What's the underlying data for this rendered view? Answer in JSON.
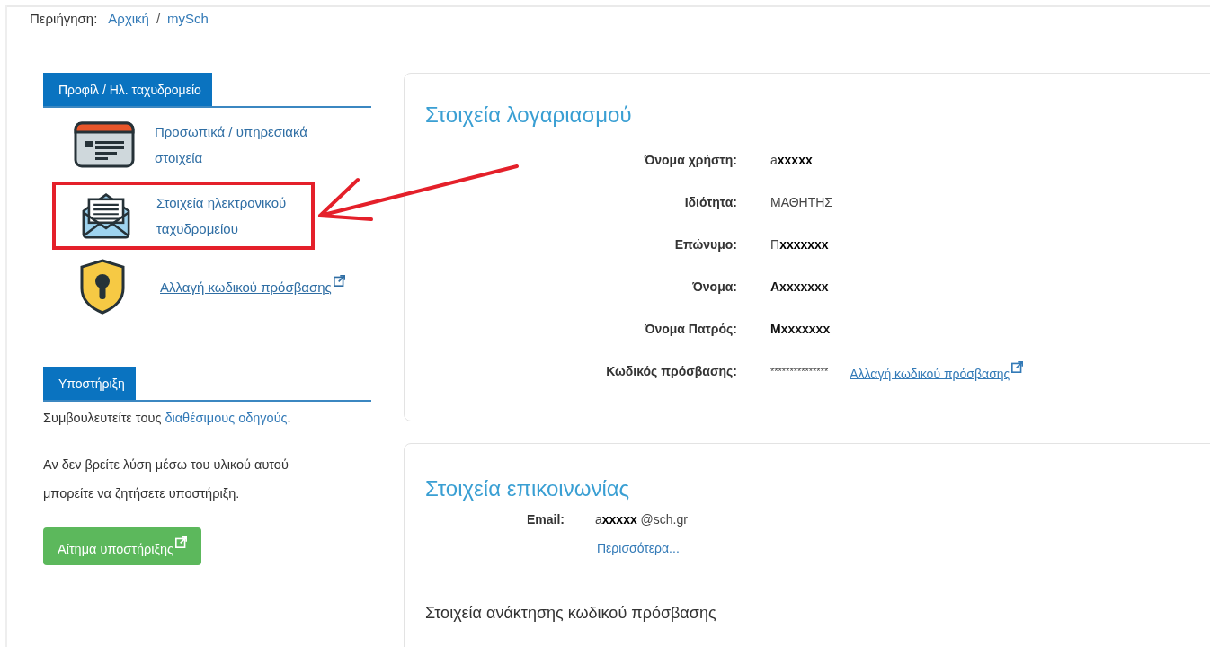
{
  "breadcrumb": {
    "label": "Περιήγηση:",
    "separator": "/",
    "items": [
      {
        "text": "Αρχική"
      },
      {
        "text": "mySch"
      }
    ]
  },
  "profile": {
    "header": "Προφίλ / Ηλ. ταχυδρομείο",
    "items": [
      {
        "kind": "card",
        "text": "Προσωπικά / υπηρεσιακά στοιχεία",
        "external": false,
        "annotated": false
      },
      {
        "kind": "mail",
        "text": "Στοιχεία ηλεκτρονικού ταχυδρομείου",
        "external": false,
        "annotated": true
      },
      {
        "kind": "shield",
        "text": "Αλλαγή κωδικού πρόσβασης",
        "external": true,
        "annotated": false
      }
    ]
  },
  "support": {
    "header": "Υποστήριξη",
    "note": {
      "before": "Συμβουλευτείτε τους ",
      "link": "διαθέσιμους οδηγούς",
      "after": "."
    },
    "paragraph": "Αν δεν βρείτε λύση μέσω του υλικού αυτού μπορείτε να ζητήσετε υποστήριξη.",
    "button": "Αίτημα υποστήριξης"
  },
  "account": {
    "title": "Στοιχεία λογαριασμού",
    "rows": [
      {
        "kind": "text",
        "label": "Όνομα χρήστη:",
        "value": "a**xxxxx**",
        "bold": false
      },
      {
        "kind": "text",
        "label": "Ιδιότητα:",
        "value": "ΜΑΘΗΤΗΣ",
        "bold": false
      },
      {
        "kind": "text",
        "label": "Επώνυμο:",
        "value": "Π**xxxxxxx**",
        "bold": false
      },
      {
        "kind": "text",
        "label": "Όνομα:",
        "value": "Axxxxxxx",
        "bold": true
      },
      {
        "kind": "text",
        "label": "Όνομα Πατρός:",
        "value": "Mxxxxxxx",
        "bold": true
      },
      {
        "kind": "password",
        "label": "Κωδικός πρόσβασης:",
        "value": "***************",
        "bold": false,
        "link": "Αλλαγή κωδικού πρόσβασης"
      }
    ]
  },
  "contact": {
    "title": "Στοιχεία επικοινωνίας",
    "rows": [
      {
        "label": "Email:",
        "value": "a**xxxxx** @sch.gr"
      }
    ],
    "more": "Περισσότερα...",
    "subtitle": "Στοιχεία ανάκτησης κωδικού πρόσβασης"
  }
}
